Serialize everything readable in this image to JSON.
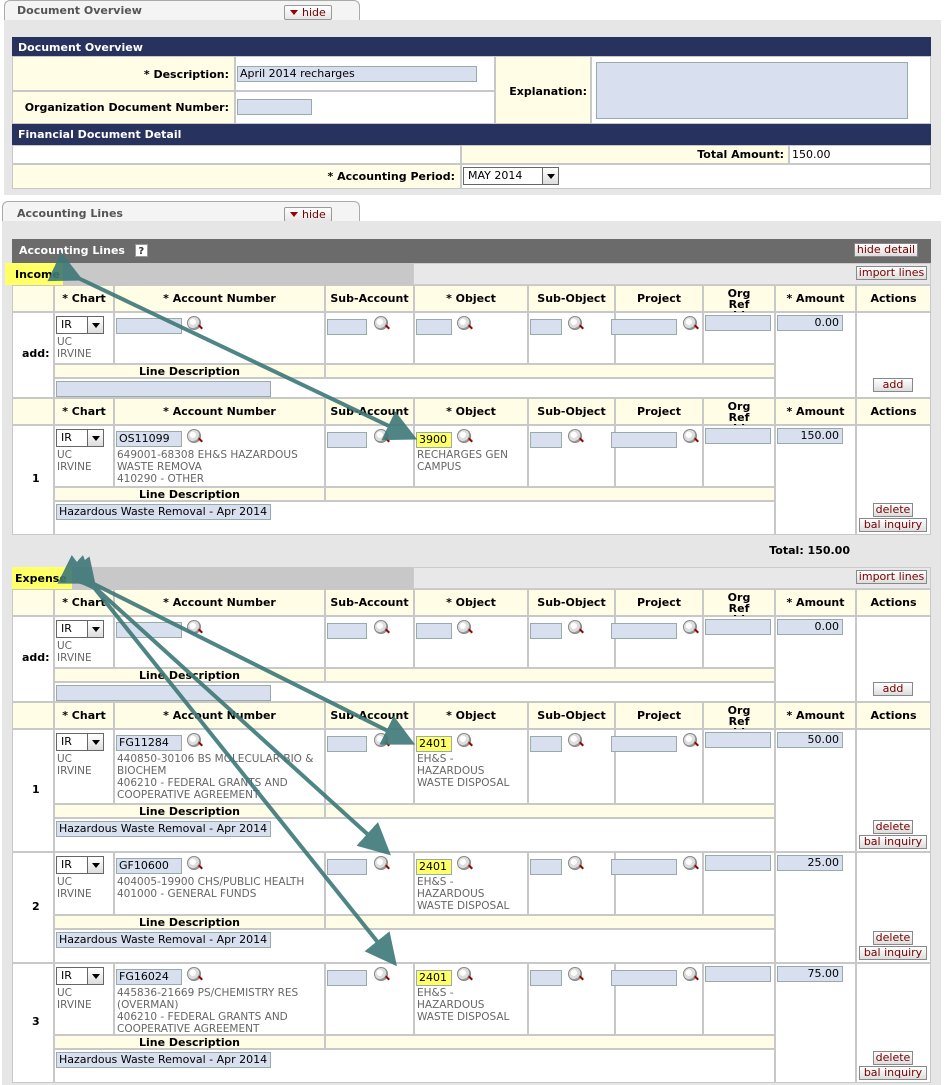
{
  "doc_tab": {
    "title": "Document Overview",
    "hide_label": "hide"
  },
  "doc_overview": {
    "header": "Document Overview",
    "description_label": "* Description:",
    "description_value": "April 2014 recharges",
    "org_doc_label": "Organization Document Number:",
    "explanation_label": "Explanation:"
  },
  "fin_detail": {
    "header": "Financial Document Detail",
    "total_amount_label": "Total Amount:",
    "total_amount_value": "150.00",
    "accounting_period_label": "* Accounting Period:",
    "accounting_period_value": "MAY 2014"
  },
  "acct_tab": {
    "title": "Accounting Lines",
    "hide_label": "hide"
  },
  "acct_lines": {
    "header": "Accounting Lines",
    "help_icon": "?",
    "hide_detail_label": "hide detail",
    "import_lines_label": "import lines",
    "add_label": "add:",
    "add_button": "add",
    "delete_button": "delete",
    "bal_inquiry_button": "bal inquiry",
    "line_description_label": "Line Description",
    "columns": [
      "* Chart",
      "* Account Number",
      "Sub-Account",
      "* Object",
      "Sub-Object",
      "Project",
      "Org Ref Id",
      "* Amount",
      "Actions"
    ],
    "income": {
      "label": "Income",
      "add_row": {
        "chart": "IR",
        "chart_name": "UC\nIRVINE",
        "amount": "0.00"
      },
      "lines": [
        {
          "num": "1",
          "chart": "IR",
          "chart_name": "UC\nIRVINE",
          "account": "OS11099",
          "account_desc": "649001-68308 EH&S HAZARDOUS\nWASTE REMOVA\n410290 - OTHER",
          "object": "3900",
          "object_desc": "RECHARGES GEN\nCAMPUS",
          "amount": "150.00",
          "line_description": "Hazardous Waste Removal - Apr 2014"
        }
      ],
      "total": "Total: 150.00"
    },
    "expense": {
      "label": "Expense",
      "add_row": {
        "chart": "IR",
        "chart_name": "UC\nIRVINE",
        "amount": "0.00"
      },
      "lines": [
        {
          "num": "1",
          "chart": "IR",
          "chart_name": "UC\nIRVINE",
          "account": "FG11284",
          "account_desc": "440850-30106 BS MOLECULAR BIO &\nBIOCHEM\n406210 - FEDERAL GRANTS AND\nCOOPERATIVE AGREEMENT",
          "object": "2401",
          "object_desc": "EH&S -\nHAZARDOUS\nWASTE DISPOSAL",
          "amount": "50.00",
          "line_description": "Hazardous Waste Removal - Apr 2014"
        },
        {
          "num": "2",
          "chart": "IR",
          "chart_name": "UC\nIRVINE",
          "account": "GF10600",
          "account_desc": "404005-19900 CHS/PUBLIC HEALTH\n401000 - GENERAL FUNDS",
          "object": "2401",
          "object_desc": "EH&S -\nHAZARDOUS\nWASTE DISPOSAL",
          "amount": "25.00",
          "line_description": "Hazardous Waste Removal - Apr 2014"
        },
        {
          "num": "3",
          "chart": "IR",
          "chart_name": "UC\nIRVINE",
          "account": "FG16024",
          "account_desc": "445836-21669 PS/CHEMISTRY RES\n(OVERMAN)\n406210 - FEDERAL GRANTS AND\nCOOPERATIVE AGREEMENT",
          "object": "2401",
          "object_desc": "EH&S -\nHAZARDOUS\nWASTE DISPOSAL",
          "amount": "75.00",
          "line_description": "Hazardous Waste Removal - Apr 2014"
        }
      ]
    }
  },
  "colors": {
    "section_header": "#27325e",
    "gray_header": "#6b6b6b",
    "highlight": "#ffff66",
    "cream": "#fffde6",
    "arrow": "#3e7878"
  }
}
